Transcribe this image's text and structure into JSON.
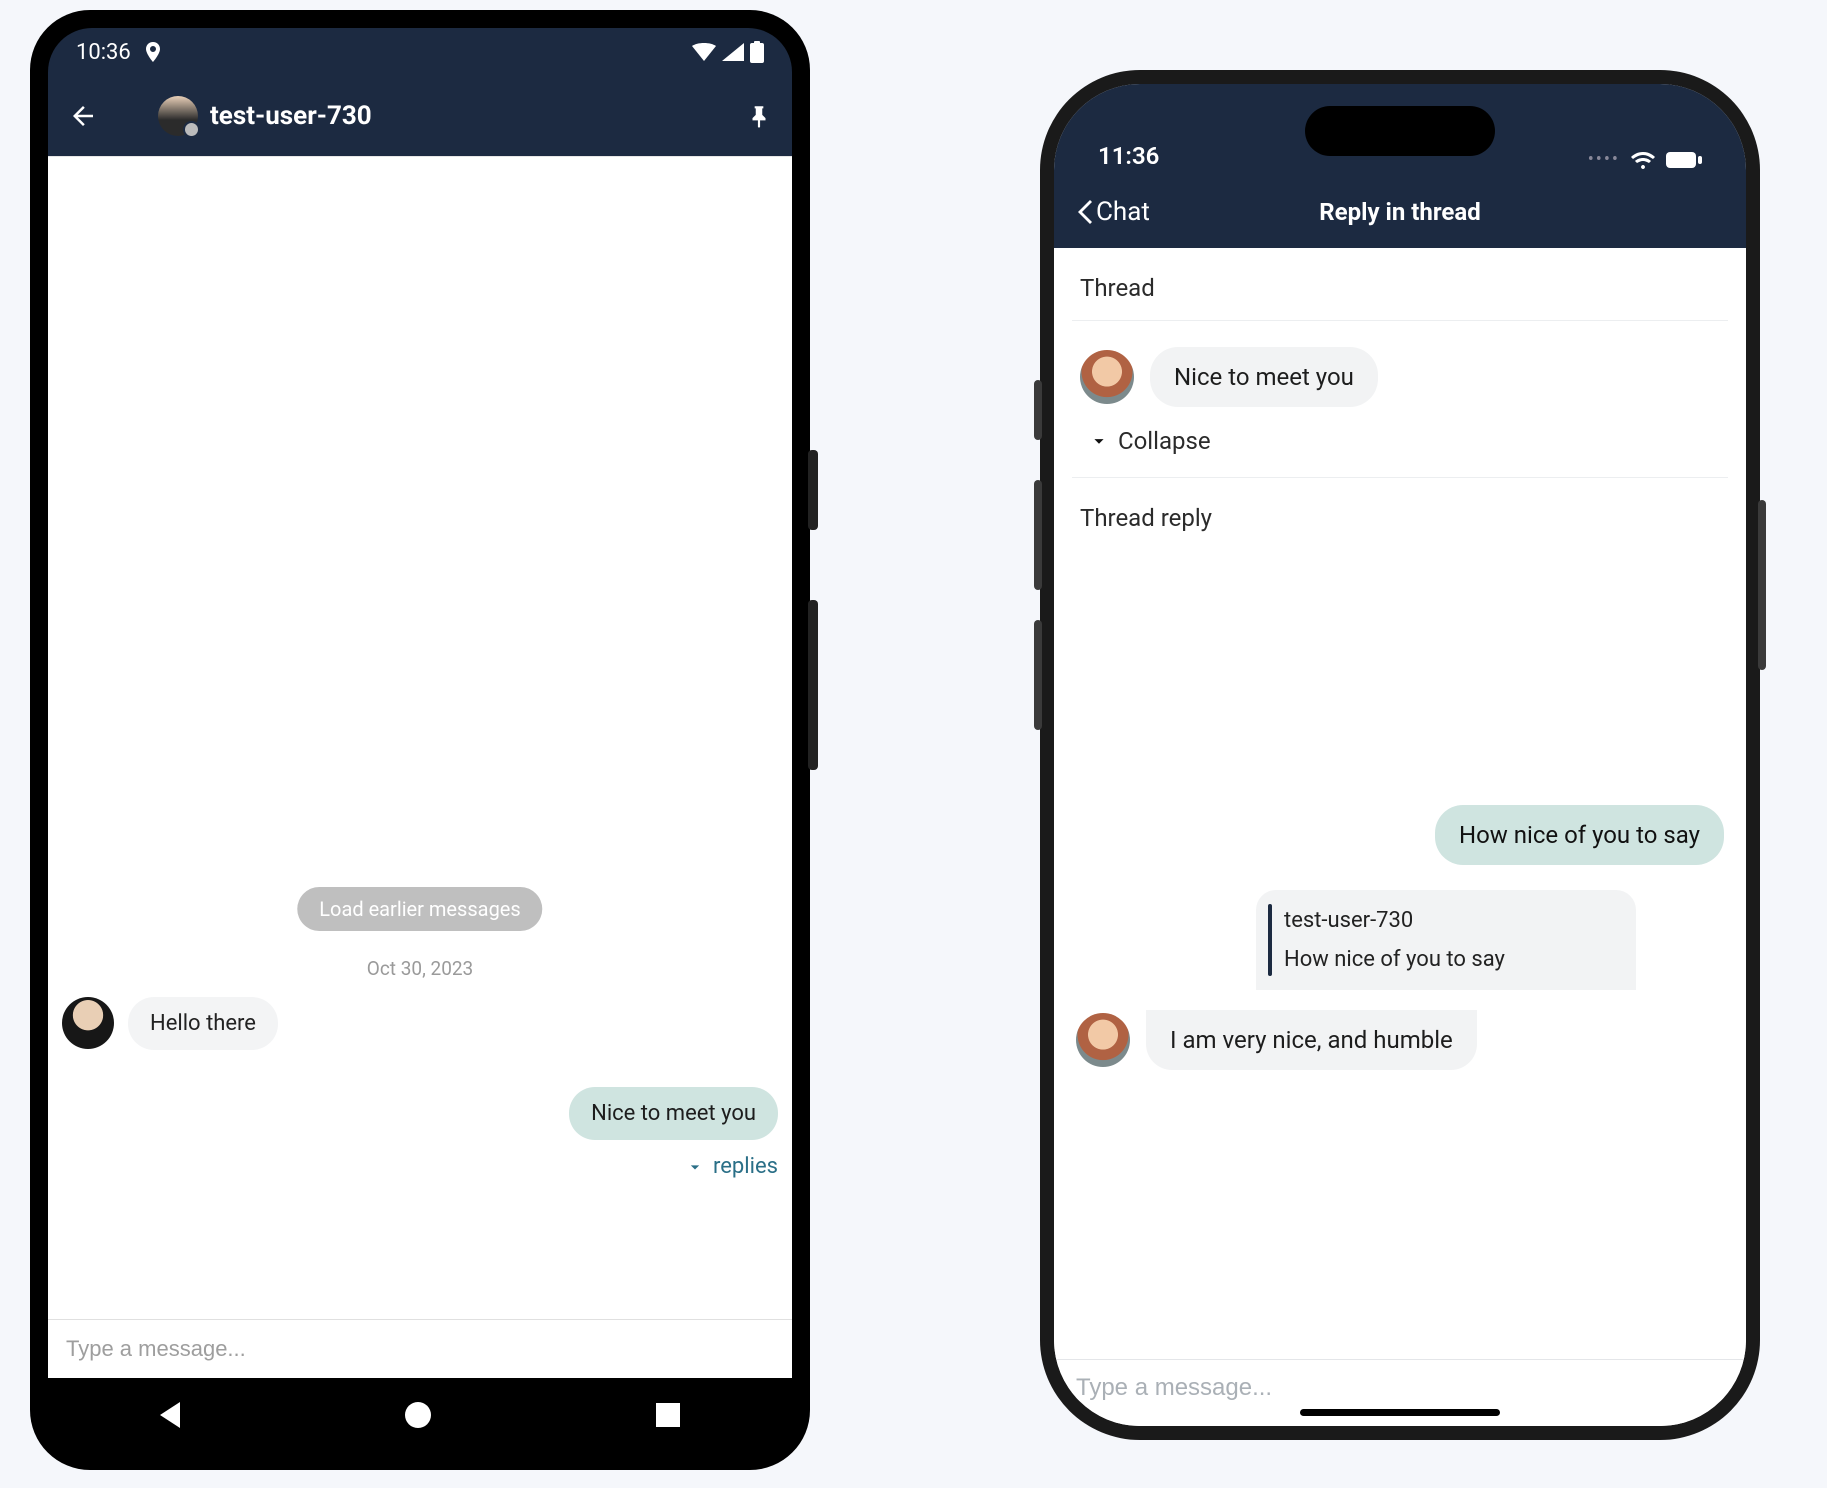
{
  "android": {
    "status": {
      "time": "10:36"
    },
    "header": {
      "user": "test-user-730"
    },
    "chat": {
      "load_earlier": "Load earlier messages",
      "date": "Oct 30, 2023",
      "msg_hello": "Hello there",
      "msg_nice": "Nice to meet you",
      "replies_label": "replies"
    },
    "input_placeholder": "Type a message..."
  },
  "ios": {
    "status": {
      "time": "11:36"
    },
    "header": {
      "back_label": "Chat",
      "title": "Reply in thread"
    },
    "thread_label": "Thread",
    "original_msg": "Nice to meet you",
    "collapse_label": "Collapse",
    "thread_reply_label": "Thread reply",
    "reply_out": "How nice of you to say",
    "quote": {
      "user": "test-user-730",
      "text": "How nice of you to say"
    },
    "reply_in": "I am very nice, and humble",
    "input_placeholder": "Type a message..."
  }
}
